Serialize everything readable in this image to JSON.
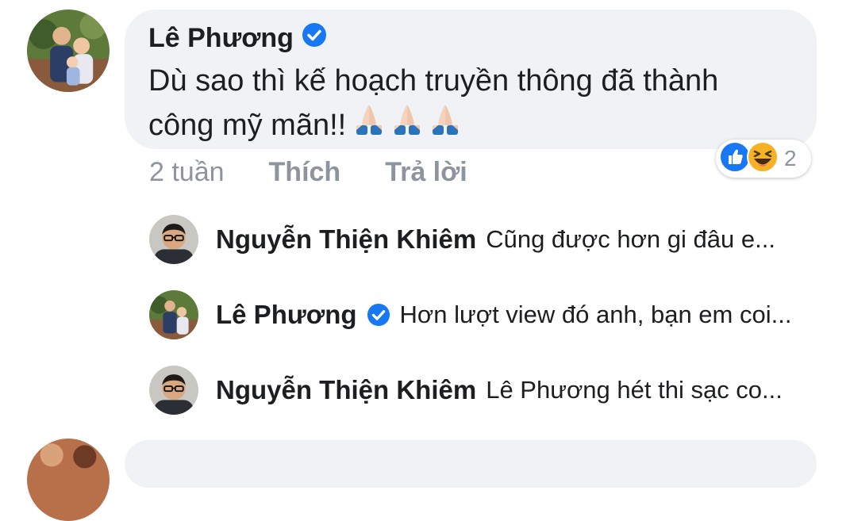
{
  "main_comment": {
    "author": "Lê Phương",
    "verified_icon": "verified-check-icon",
    "text_line1": "Dù sao thì kế hoạch truyền thông đã thành",
    "text_line2": "công mỹ mãn!!",
    "emojis": [
      "folded-hands-icon",
      "folded-hands-icon",
      "folded-hands-icon"
    ],
    "time": "2 tuần",
    "like_label": "Thích",
    "reply_label": "Trả lời",
    "reactions": {
      "icons": [
        "like-reaction-icon",
        "haha-reaction-icon"
      ],
      "count": "2"
    }
  },
  "replies": [
    {
      "author": "Nguyễn Thiện Khiêm",
      "verified": false,
      "text": "Cũng được  hơn gi đâu e..."
    },
    {
      "author": "Lê Phương",
      "verified": true,
      "text": "Hơn lượt view đó anh, bạn em coi..."
    },
    {
      "author": "Nguyễn Thiện Khiêm",
      "verified": false,
      "text": "Lê Phương hét thi sạc co..."
    }
  ],
  "colors": {
    "bubble_bg": "#f0f2f5",
    "text": "#1c1e21",
    "meta": "#8d949e",
    "facebook_blue": "#1877f2",
    "haha_yellow": "#f7b125"
  }
}
